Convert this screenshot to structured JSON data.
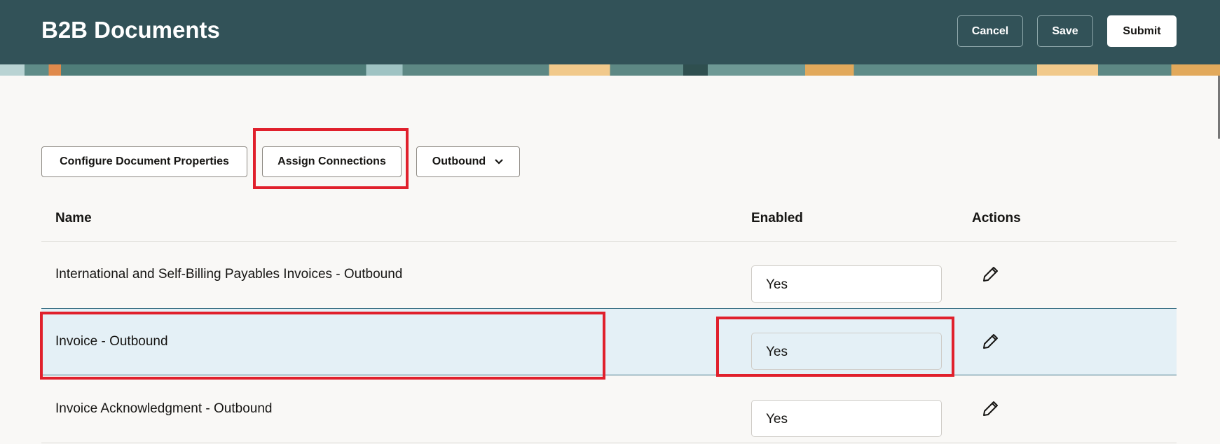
{
  "header": {
    "title": "B2B Documents",
    "cancel": "Cancel",
    "save": "Save",
    "submit": "Submit"
  },
  "toolbar": {
    "configure": "Configure Document Properties",
    "assign": "Assign Connections",
    "direction": "Outbound"
  },
  "table": {
    "columns": [
      "Name",
      "Enabled",
      "Actions"
    ],
    "rows": [
      {
        "name": "International and Self-Billing Payables Invoices - Outbound",
        "enabled": "Yes",
        "selected": false
      },
      {
        "name": "Invoice - Outbound",
        "enabled": "Yes",
        "selected": true
      },
      {
        "name": "Invoice Acknowledgment - Outbound",
        "enabled": "Yes",
        "selected": false
      }
    ]
  },
  "colors": {
    "header": "#325258",
    "highlight": "#e0202c",
    "selected_row": "#e4f0f6"
  }
}
